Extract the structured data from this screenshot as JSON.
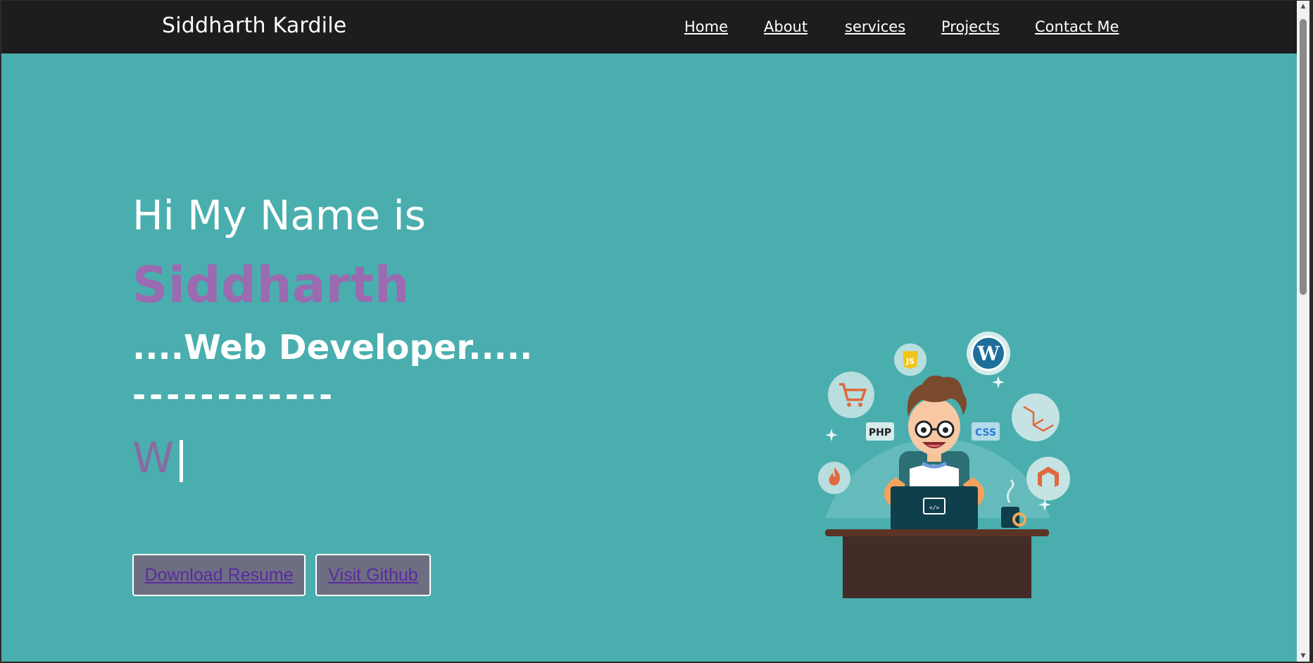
{
  "navbar": {
    "brand": "Siddharth Kardile",
    "links": [
      {
        "label": "Home"
      },
      {
        "label": "About"
      },
      {
        "label": "services"
      },
      {
        "label": "Projects"
      },
      {
        "label": "Contact Me"
      }
    ]
  },
  "hero": {
    "greeting": "Hi My Name is",
    "name": "Siddharth",
    "role": "....Web Developer.....",
    "divider": "------------",
    "typed_text": "W",
    "typed_cursor": "|",
    "buttons": {
      "download_resume": "Download Resume",
      "visit_github": "Visit Github"
    },
    "illustration": {
      "badges": [
        "PHP",
        "CSS",
        "JS"
      ],
      "icons": [
        "cart-icon",
        "javascript-icon",
        "wordpress-icon",
        "laravel-icon",
        "codeigniter-icon",
        "magento-icon",
        "laptop-icon",
        "coffee-mug-icon",
        "sparkle-icon"
      ]
    }
  },
  "colors": {
    "navbar_bg": "#1e1c1f",
    "hero_bg": "#4aaeae",
    "name_color": "#9b6ab0",
    "typed_color": "#8a6aa4",
    "button_bg": "#6e6e82",
    "button_text": "#5a2aa0"
  }
}
